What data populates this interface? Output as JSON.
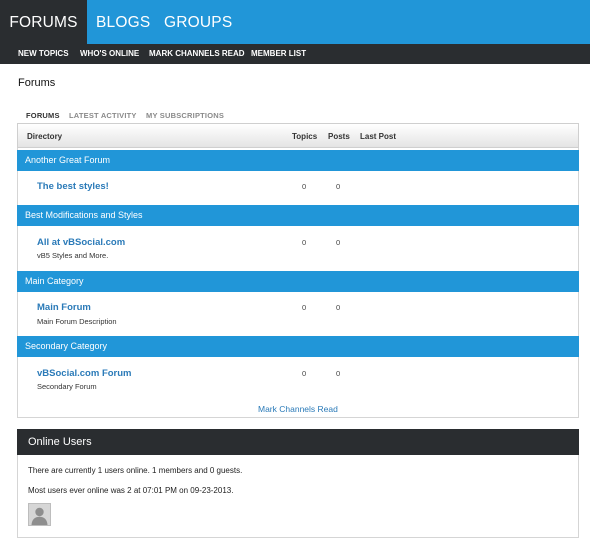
{
  "topnav": {
    "tabs": [
      {
        "label": "FORUMS"
      },
      {
        "label": "BLOGS"
      },
      {
        "label": "GROUPS"
      }
    ],
    "active": "FORUMS"
  },
  "subnav": {
    "items": [
      {
        "label": "NEW TOPICS"
      },
      {
        "label": "WHO'S ONLINE"
      },
      {
        "label": "MARK CHANNELS READ"
      },
      {
        "label": "MEMBER LIST"
      }
    ]
  },
  "page": {
    "title": "Forums"
  },
  "subtabs": {
    "items": [
      {
        "label": "FORUMS"
      },
      {
        "label": "LATEST ACTIVITY"
      },
      {
        "label": "MY SUBSCRIPTIONS"
      }
    ],
    "active": "FORUMS"
  },
  "table": {
    "headers": {
      "directory": "Directory",
      "topics": "Topics",
      "posts": "Posts",
      "last_post": "Last Post"
    },
    "categories": [
      {
        "name": "Another Great Forum",
        "forums": [
          {
            "name": "The best styles!",
            "description": "",
            "topics": "0",
            "posts": "0"
          }
        ]
      },
      {
        "name": "Best Modifications and Styles",
        "forums": [
          {
            "name": "All at vBSocial.com",
            "description": "vB5 Styles and More.",
            "topics": "0",
            "posts": "0"
          }
        ]
      },
      {
        "name": "Main Category",
        "forums": [
          {
            "name": "Main Forum",
            "description": "Main Forum Description",
            "topics": "0",
            "posts": "0"
          }
        ]
      },
      {
        "name": "Secondary Category",
        "forums": [
          {
            "name": "vBSocial.com Forum",
            "description": "Secondary Forum",
            "topics": "0",
            "posts": "0"
          }
        ]
      }
    ],
    "mark_read": "Mark Channels Read"
  },
  "online": {
    "title": "Online Users",
    "line1": "There are currently 1 users online. 1 members and 0 guests.",
    "line2": "Most users ever online was 2 at 07:01 PM on 09-23-2013."
  },
  "colors": {
    "accent": "#2196d8",
    "dark": "#2a2d30",
    "link": "#2a7ab8"
  },
  "icons": {
    "avatar": "user-silhouette-icon"
  }
}
